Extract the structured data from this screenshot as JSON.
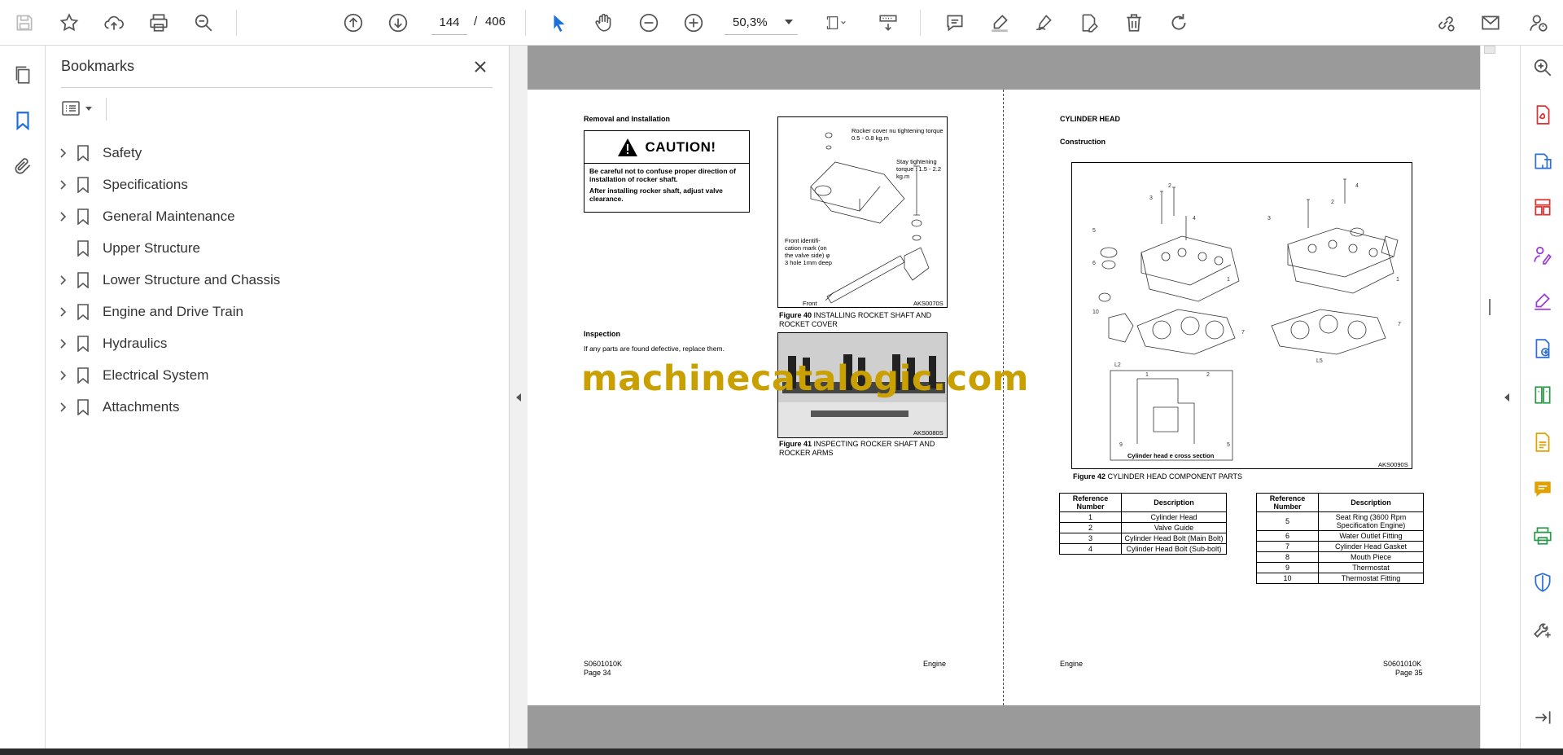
{
  "toolbar": {
    "current_page": "144",
    "page_separator": "/",
    "total_pages": "406",
    "zoom": "50,3%"
  },
  "bookmarks": {
    "title": "Bookmarks",
    "items": [
      {
        "label": "Safety",
        "expandable": true
      },
      {
        "label": "Specifications",
        "expandable": true
      },
      {
        "label": "General Maintenance",
        "expandable": true
      },
      {
        "label": "Upper Structure",
        "expandable": false
      },
      {
        "label": "Lower Structure and Chassis",
        "expandable": true
      },
      {
        "label": "Engine and Drive Train",
        "expandable": true
      },
      {
        "label": "Hydraulics",
        "expandable": true
      },
      {
        "label": "Electrical System",
        "expandable": true
      },
      {
        "label": "Attachments",
        "expandable": true
      }
    ]
  },
  "document": {
    "left_page": {
      "heading_removal": "Removal and Installation",
      "caution_title": "CAUTION!",
      "caution_line1": "Be careful not to confuse proper direction of installation of rocker shaft.",
      "caution_line2": "After installing rocker shaft, adjust valve clearance.",
      "heading_inspection": "Inspection",
      "inspection_text": "If any parts are found defective, replace them.",
      "fig40_labels": {
        "rocker_cover": "Rocker cover nu tightening torque 0.5 - 0.8 kg.m",
        "stay": "Stay tightening torque : 1.5 - 2.2 kg.m",
        "front_mark": "Front identifi- cation mark (on the valve side) φ 3 hole 1mm deep",
        "front": "Front",
        "code": "AKS0070S"
      },
      "fig40_num": "Figure 40",
      "fig40_caption": "INSTALLING ROCKET SHAFT AND ROCKET COVER",
      "fig41_code": "AKS0080S",
      "fig41_num": "Figure 41",
      "fig41_caption": "INSPECTING ROCKER SHAFT AND ROCKER ARMS",
      "footer_code": "S0601010K",
      "footer_page": "Page 34",
      "footer_section": "Engine"
    },
    "right_page": {
      "heading": "CYLINDER HEAD",
      "subheading": "Construction",
      "fig42_inset_label": "Cylinder head  e cross section",
      "fig42_code": "AKS0090S",
      "fig42_num": "Figure 42",
      "fig42_caption": "CYLINDER HEAD COMPONENT PARTS",
      "table_headers": [
        "Reference Number",
        "Description"
      ],
      "table_left": [
        {
          "num": "1",
          "desc": "Cylinder Head"
        },
        {
          "num": "2",
          "desc": "Valve Guide"
        },
        {
          "num": "3",
          "desc": "Cylinder Head Bolt (Main Bolt)"
        },
        {
          "num": "4",
          "desc": "Cylinder Head Bolt (Sub-bolt)"
        }
      ],
      "table_right": [
        {
          "num": "5",
          "desc": "Seat Ring (3600 Rpm Specification Engine)"
        },
        {
          "num": "6",
          "desc": "Water Outlet Fitting"
        },
        {
          "num": "7",
          "desc": "Cylinder Head Gasket"
        },
        {
          "num": "8",
          "desc": "Mouth Piece"
        },
        {
          "num": "9",
          "desc": "Thermostat"
        },
        {
          "num": "10",
          "desc": "Thermostat Fitting"
        }
      ],
      "footer_section": "Engine",
      "footer_code": "S0601010K",
      "footer_page": "Page 35"
    },
    "watermark": "machinecatalogic.com"
  },
  "icons": {
    "toolbar": [
      "save-icon",
      "bookmark-star-icon",
      "upload-icon",
      "print-icon",
      "zoom-search-icon",
      "page-up-icon",
      "page-down-icon",
      "select-cursor-icon",
      "hand-icon",
      "zoom-out-icon",
      "zoom-in-icon",
      "page-fit-icon",
      "scroll-mode-icon",
      "comment-icon",
      "highlight-icon",
      "sign-icon",
      "edit-pdf-icon",
      "delete-icon",
      "rotate-icon",
      "share-link-icon",
      "email-icon",
      "account-help-icon"
    ],
    "right_rail_colors": {
      "red": "#e0312f",
      "blue": "#2e6fd6",
      "purple": "#9b3ad6",
      "green": "#2a9a4a",
      "yellow": "#e3a100",
      "gray": "#555555"
    }
  }
}
